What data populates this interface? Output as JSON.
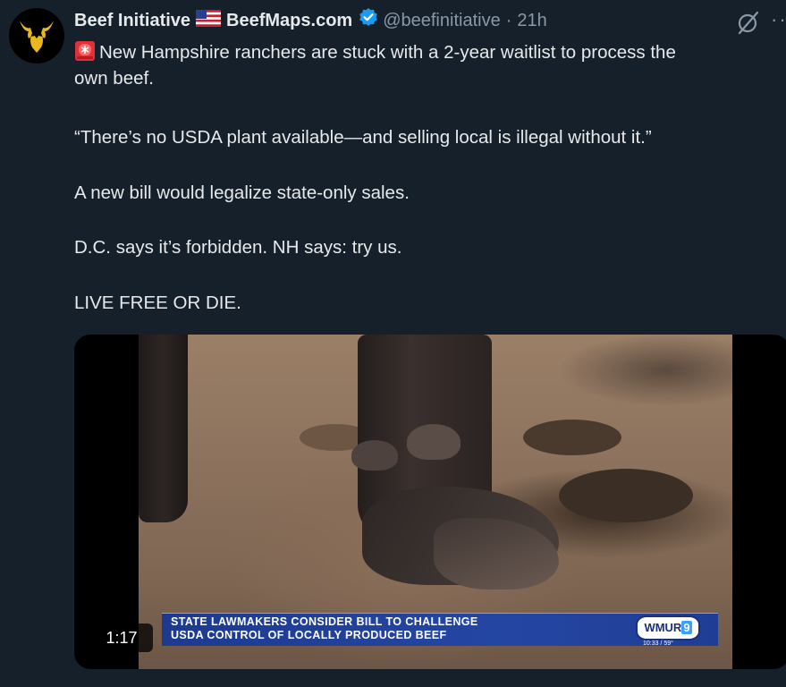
{
  "tweet": {
    "author_name": "Beef Initiative",
    "author_name_2": "BeefMaps.com",
    "handle": "@beefinitiative",
    "separator": "·",
    "time": "21h",
    "more_label": "··",
    "line1": "New Hampshire ranchers are stuck with a 2-year waitlist to process the",
    "line1_cont": "own beef.",
    "p2": "“There’s no USDA plant available—and selling local is illegal without it.”",
    "p3": "A new bill would legalize state-only sales.",
    "p4": "D.C. says it’s forbidden. NH says: try us.",
    "p5": "LIVE FREE OR DIE."
  },
  "video": {
    "duration": "1:17",
    "chyron_line1": "STATE LAWMAKERS CONSIDER BILL TO CHALLENGE",
    "chyron_line2": "USDA CONTROL OF LOCALLY PRODUCED BEEF",
    "station_name": "WMUR",
    "station_number": "9",
    "station_time": "10:33 / 59°"
  },
  "colors": {
    "background": "#15202b",
    "text": "#e7e9ea",
    "secondary": "#8b98a5",
    "verified": "#1d9bf0",
    "avatar_gold": "#e8b81c"
  },
  "icons": [
    "bull-logo-icon",
    "us-flag-icon",
    "verified-badge-icon",
    "grok-icon",
    "more-icon",
    "siren-icon"
  ]
}
